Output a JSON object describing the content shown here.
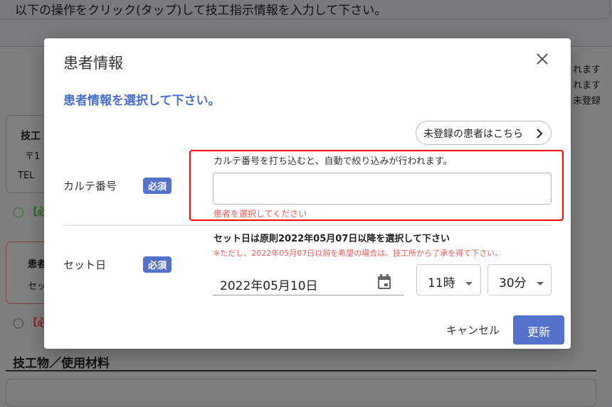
{
  "background": {
    "top_text": "以下の操作をクリック(タップ)して技工指示情報を入力して下さい。",
    "lab_card": {
      "title": "技工",
      "zip": "〒1",
      "tel": "TEL"
    },
    "req_ok": "【必",
    "patient_card": {
      "title": "患者",
      "set": "セッ"
    },
    "req_ng": "【必",
    "right_lines": [
      "れます",
      "れます",
      "未登録"
    ],
    "section_title": "技工物／使用材料"
  },
  "dialog": {
    "title": "患者情報",
    "subtitle": "患者情報を選択して下さい。",
    "unregistered_button": "未登録の患者はこちら",
    "chart_number": {
      "label": "カルテ番号",
      "badge": "必須",
      "hint": "カルテ番号を打ち込むと、自動で絞り込みが行われます。",
      "value": "",
      "error": "患者を選択してください"
    },
    "set_date": {
      "label": "セット日",
      "badge": "必須",
      "note": "セット日は原則2022年05月07日以降を選択して下さい",
      "warning": "※ただし、2022年05月07日以前を希望の場合は、技工所から了承を得て下さい。",
      "date": "2022年05月10日",
      "hour": "11時",
      "minute": "30分"
    },
    "cancel_label": "キャンセル",
    "update_label": "更新"
  },
  "colors": {
    "accent": "#5472c9",
    "error": "#f05a5a",
    "highlight": "#ff0000"
  }
}
